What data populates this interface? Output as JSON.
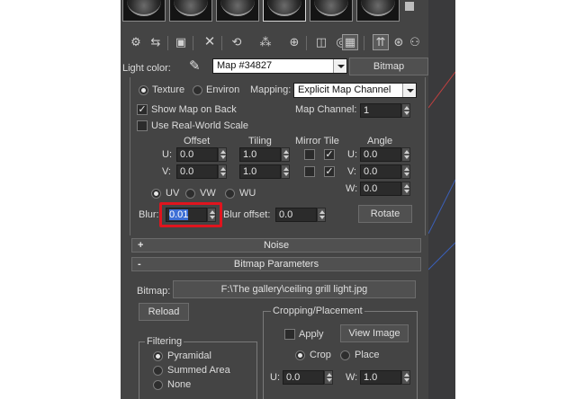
{
  "toolbar": {
    "icons": [
      "get-material-icon",
      "put-material-icon",
      "assign-material-icon",
      "delete-icon",
      "copy-material-icon",
      "make-unique-icon",
      "material-library-icon",
      "material-id-icon",
      "show-map-icon",
      "show-background-icon",
      "go-to-parent-icon",
      "go-forward-icon"
    ]
  },
  "map_row": {
    "label": "Light color:",
    "map_name": "Map #34827",
    "map_type": "Bitmap"
  },
  "coordinates": {
    "texture_label": "Texture",
    "environ_label": "Environ",
    "mapping_label": "Mapping:",
    "mapping_value": "Explicit Map Channel",
    "show_map_on_back": "Show Map on Back",
    "map_channel_label": "Map Channel:",
    "map_channel_value": "1",
    "real_world_scale": "Use Real-World Scale",
    "headers": {
      "offset": "Offset",
      "tiling": "Tiling",
      "mirror_tile": "Mirror Tile",
      "angle": "Angle"
    },
    "u_label": "U:",
    "v_label": "V:",
    "w_label": "W:",
    "offset_u": "0.0",
    "offset_v": "0.0",
    "tiling_u": "1.0",
    "tiling_v": "1.0",
    "angle_u": "0.0",
    "angle_v": "0.0",
    "angle_w": "0.0",
    "uv_label": "UV",
    "vw_label": "VW",
    "wu_label": "WU",
    "blur_label": "Blur:",
    "blur_value": "0.01",
    "blur_offset_label": "Blur offset:",
    "blur_offset_value": "0.0",
    "rotate_label": "Rotate"
  },
  "rollouts": {
    "noise": "Noise",
    "noise_sign": "+",
    "bitmap_params": "Bitmap Parameters",
    "bitmap_params_sign": "-"
  },
  "bitmap": {
    "label": "Bitmap:",
    "path": "F:\\The gallery\\ceiling grill light.jpg",
    "reload": "Reload",
    "filtering_title": "Filtering",
    "pyramidal": "Pyramidal",
    "summed_area": "Summed Area",
    "none": "None",
    "cropping_title": "Cropping/Placement",
    "apply": "Apply",
    "view_image": "View Image",
    "crop": "Crop",
    "place": "Place",
    "u_label": "U:",
    "u_value": "0.0",
    "w_label": "W:",
    "w_value": "1.0"
  },
  "colors": {
    "panel_bg": "#444444",
    "highlight_red": "#e0141e",
    "selection_blue": "#3d6fd6"
  }
}
